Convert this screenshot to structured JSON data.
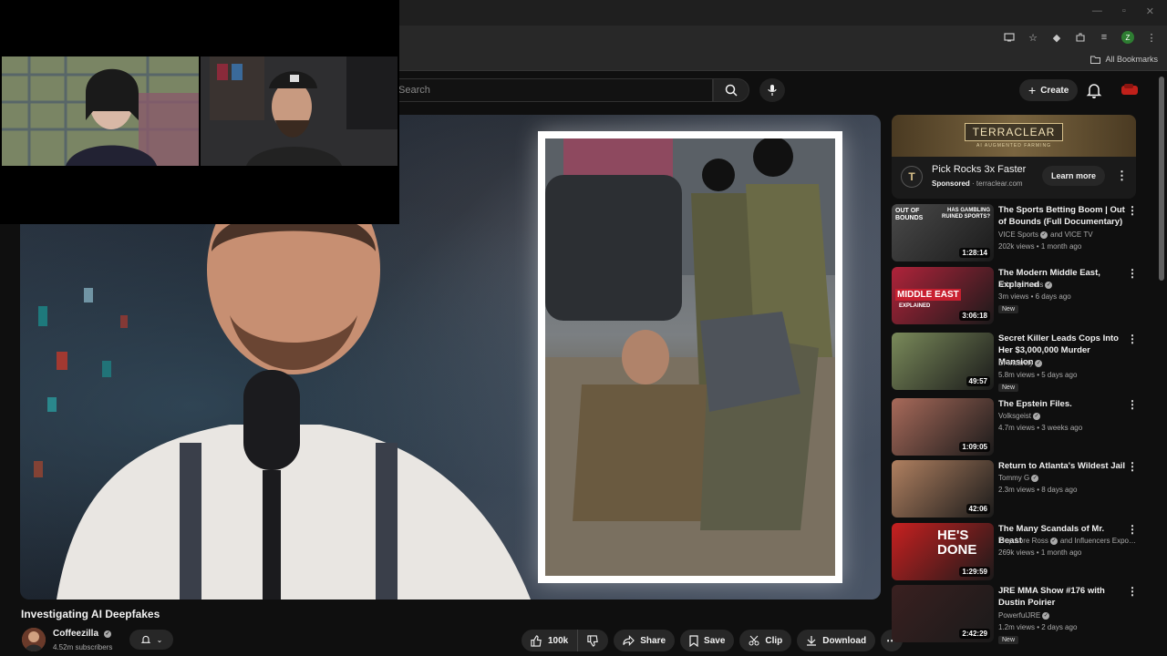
{
  "browser": {
    "bookmarks_label": "All Bookmarks",
    "profile_initial": "Z"
  },
  "header": {
    "search_placeholder": "Search",
    "create_label": "Create"
  },
  "video": {
    "title": "Investigating AI Deepfakes",
    "channel": "Coffeezilla",
    "subscribers": "4.52m subscribers",
    "likes": "100k",
    "share_label": "Share",
    "save_label": "Save",
    "clip_label": "Clip",
    "download_label": "Download"
  },
  "ad": {
    "banner_title": "TERRACLEAR",
    "banner_sub": "AI AUGMENTED FARMING",
    "logo_letter": "T",
    "title": "Pick Rocks 3x Faster",
    "sponsored": "Sponsored",
    "domain": "terraclear.com",
    "cta": "Learn more"
  },
  "recommendations": [
    {
      "title": "The Sports Betting Boom | Out of Bounds (Full Documentary)",
      "channel": "VICE Sports",
      "channel_suffix": "and VICE TV",
      "stats": "202k views • 1 month ago",
      "duration": "1:28:14",
      "new": "",
      "thumb_color": "#4a4a4a"
    },
    {
      "title": "The Modern Middle East, Explained",
      "channel": "Johnny Harris",
      "channel_suffix": "",
      "stats": "3m views • 6 days ago",
      "duration": "3:06:18",
      "new": "New",
      "thumb_color": "#b0233a"
    },
    {
      "title": "Secret Killer Leads Cops Into Her $3,000,000 Murder Mansion",
      "channel": "Dr Insanity",
      "channel_suffix": "",
      "stats": "5.8m views • 5 days ago",
      "duration": "49:57",
      "new": "New",
      "thumb_color": "#7a8a5a"
    },
    {
      "title": "The Epstein Files.",
      "channel": "Volksgeist",
      "channel_suffix": "",
      "stats": "4.7m views • 3 weeks ago",
      "duration": "1:09:05",
      "new": "",
      "thumb_color": "#a86a5a"
    },
    {
      "title": "Return to Atlanta's Wildest Jail",
      "channel": "Tommy G",
      "channel_suffix": "",
      "stats": "2.3m views • 8 days ago",
      "duration": "42:06",
      "new": "",
      "thumb_color": "#b08060"
    },
    {
      "title": "The Many Scandals of Mr. Beast",
      "channel": "Trap Lore Ross",
      "channel_suffix": "and Influencers Expo…",
      "stats": "269k views • 1 month ago",
      "duration": "1:29:59",
      "new": "",
      "thumb_color": "#c82020"
    },
    {
      "title": "JRE MMA Show #176 with Dustin Poirier",
      "channel": "PowerfulJRE",
      "channel_suffix": "",
      "stats": "1.2m views • 2 days ago",
      "duration": "2:42:29",
      "new": "New",
      "thumb_color": "#3a2020"
    }
  ],
  "thumb_overlays": {
    "vice_text": "OUT OF BOUNDS",
    "vice_subtext": "HAS GAMBLING RUINED SPORTS?",
    "middle_east_text": "MIDDLE EAST",
    "middle_east_sub": "EXPLAINED",
    "beast_text": "HE'S DONE"
  }
}
